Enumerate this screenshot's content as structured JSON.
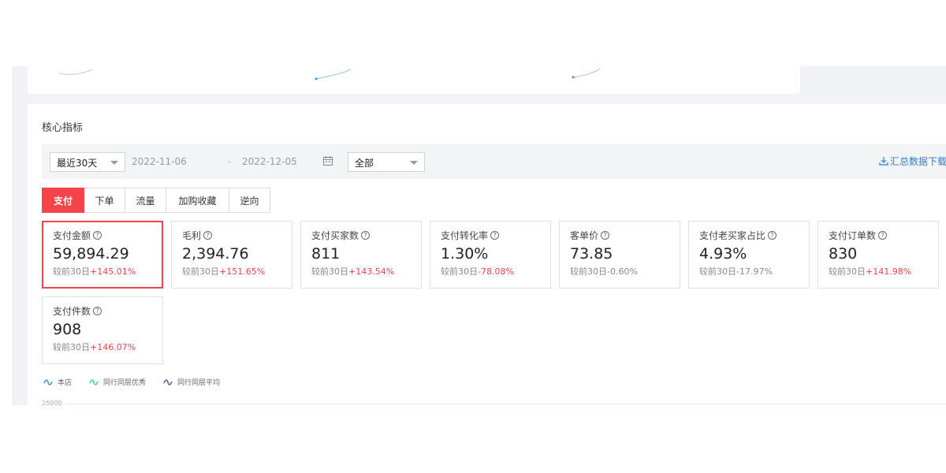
{
  "section_title": "核心指标",
  "filters": {
    "range": "最近30天",
    "date_start": "2022-11-06",
    "date_separator": "-",
    "date_end": "2022-12-05",
    "scope": "全部",
    "download_label": "汇总数据下载"
  },
  "tabs": [
    {
      "label": "支付",
      "active": true
    },
    {
      "label": "下单",
      "active": false
    },
    {
      "label": "流量",
      "active": false
    },
    {
      "label": "加购收藏",
      "active": false
    },
    {
      "label": "逆向",
      "active": false
    }
  ],
  "metrics": [
    {
      "label": "支付金额",
      "value": "59,894.29",
      "compare_label": "较前30日",
      "change": "+145.01%",
      "highlight": true,
      "active": true
    },
    {
      "label": "毛利",
      "value": "2,394.76",
      "compare_label": "较前30日",
      "change": "+151.65%",
      "highlight": true,
      "active": false
    },
    {
      "label": "支付买家数",
      "value": "811",
      "compare_label": "较前30日",
      "change": "+143.54%",
      "highlight": true,
      "active": false
    },
    {
      "label": "支付转化率",
      "value": "1.30%",
      "compare_label": "较前30日",
      "change": "-78.08%",
      "highlight": true,
      "active": false
    },
    {
      "label": "客单价",
      "value": "73.85",
      "compare_label": "较前30日",
      "change": "-0.60%",
      "highlight": false,
      "active": false
    },
    {
      "label": "支付老买家占比",
      "value": "4.93%",
      "compare_label": "较前30日",
      "change": "-17.97%",
      "highlight": false,
      "active": false
    },
    {
      "label": "支付订单数",
      "value": "830",
      "compare_label": "较前30日",
      "change": "+141.98%",
      "highlight": true,
      "active": false
    },
    {
      "label": "支付件数",
      "value": "908",
      "compare_label": "较前30日",
      "change": "+146.07%",
      "highlight": true,
      "active": false
    }
  ],
  "legend": [
    {
      "label": "本店",
      "color": "#3b8ee0"
    },
    {
      "label": "同行同层优秀",
      "color": "#3cc9a8"
    },
    {
      "label": "同行同层平均",
      "color": "#4a5a8a"
    }
  ],
  "chart_y_tick": "25000",
  "colors": {
    "accent": "#f5434a",
    "link": "#2f7ddb"
  }
}
